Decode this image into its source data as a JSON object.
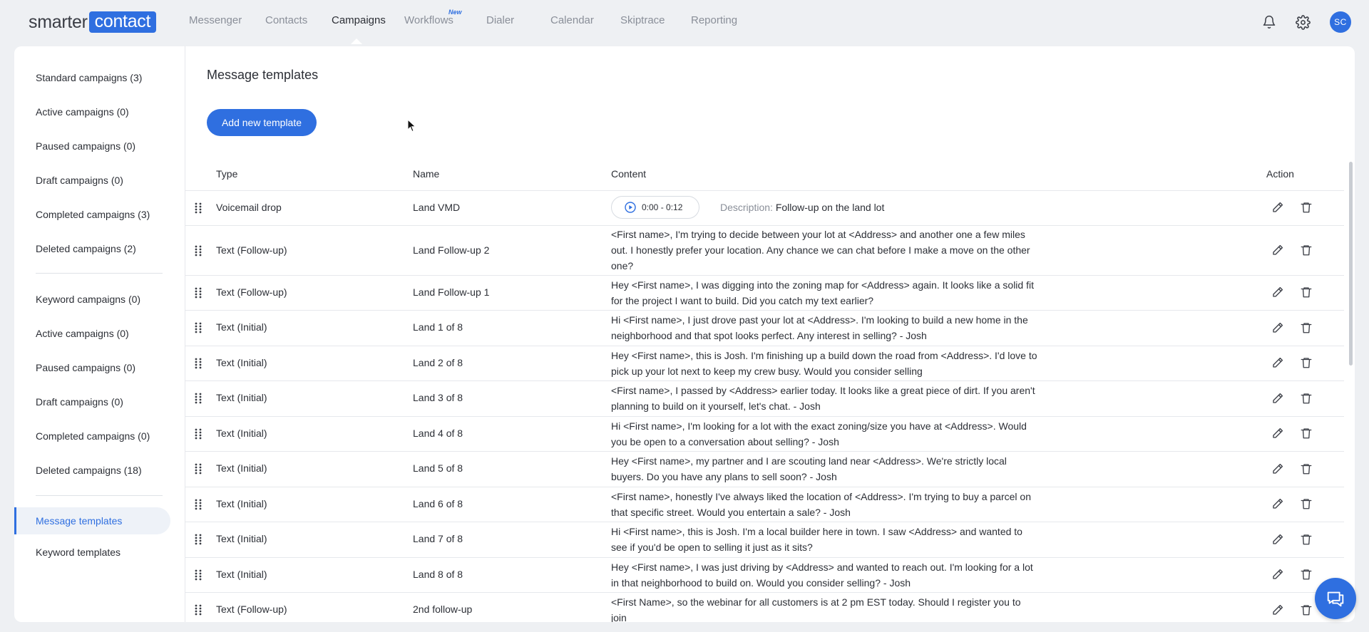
{
  "brand": {
    "part1": "smarter",
    "part2": "contact"
  },
  "nav": {
    "items": [
      "Messenger",
      "Contacts",
      "Campaigns",
      "Workflows",
      "Dialer",
      "Calendar",
      "Skiptrace",
      "Reporting"
    ],
    "active": "Campaigns",
    "workflows_badge": "New"
  },
  "user": {
    "initials": "SC"
  },
  "sidebar": {
    "standard_group": [
      "Standard campaigns (3)",
      "Active campaigns (0)",
      "Paused campaigns (0)",
      "Draft campaigns (0)",
      "Completed campaigns (3)",
      "Deleted campaigns (2)"
    ],
    "keyword_group": [
      "Keyword campaigns (0)",
      "Active campaigns (0)",
      "Paused campaigns (0)",
      "Draft campaigns (0)",
      "Completed campaigns (0)",
      "Deleted campaigns (18)"
    ],
    "templates_group": [
      "Message templates",
      "Keyword templates"
    ],
    "active_item": "Message templates"
  },
  "main": {
    "title": "Message templates",
    "add_button": "Add new template",
    "columns": {
      "type": "Type",
      "name": "Name",
      "content": "Content",
      "action": "Action"
    },
    "voicemail": {
      "type": "Voicemail drop",
      "name": "Land VMD",
      "audio_time": "0:00 - 0:12",
      "description_label": "Description:",
      "description": "Follow-up on the land lot"
    },
    "rows": [
      {
        "type": "Text (Follow-up)",
        "name": "Land Follow-up 2",
        "content": "<First name>, I'm trying to decide between your lot at <Address> and another one a few miles out. I honestly prefer your location. Any chance we can chat before I make a move on the other one?"
      },
      {
        "type": "Text (Follow-up)",
        "name": "Land Follow-up 1",
        "content": "Hey <First name>, I was digging into the zoning map for <Address> again. It looks like a solid fit for the project I want to build. Did you catch my text earlier?"
      },
      {
        "type": "Text (Initial)",
        "name": "Land 1 of 8",
        "content": "Hi <First name>, I just drove past your lot at <Address>. I'm looking to build a new home in the neighborhood and that spot looks perfect. Any interest in selling? - Josh"
      },
      {
        "type": "Text (Initial)",
        "name": "Land 2 of 8",
        "content": "Hey <First name>, this is Josh. I'm finishing up a build down the road from <Address>. I'd love to pick up your lot next to keep my crew busy. Would you consider selling"
      },
      {
        "type": "Text (Initial)",
        "name": "Land 3 of 8",
        "content": "<First name>, I passed by <Address> earlier today. It looks like a great piece of dirt. If you aren't planning to build on it yourself, let's chat. - Josh"
      },
      {
        "type": "Text (Initial)",
        "name": "Land 4 of 8",
        "content": "Hi <First name>, I'm looking for a lot with the exact zoning/size you have at <Address>. Would you be open to a conversation about selling? - Josh"
      },
      {
        "type": "Text (Initial)",
        "name": "Land 5 of 8",
        "content": "Hey <First name>, my partner and I are scouting land near <Address>. We're strictly local buyers. Do you have any plans to sell soon? - Josh"
      },
      {
        "type": "Text (Initial)",
        "name": "Land 6 of 8",
        "content": "<First name>, honestly I've always liked the location of <Address>. I'm trying to buy a parcel on that specific street. Would you entertain a sale? - Josh"
      },
      {
        "type": "Text (Initial)",
        "name": "Land 7 of 8",
        "content": "Hi <First name>, this is Josh. I'm a local builder here in town. I saw <Address> and wanted to see if you'd be open to selling it just as it sits?"
      },
      {
        "type": "Text (Initial)",
        "name": "Land 8 of 8",
        "content": "Hey <First name>, I was just driving by <Address> and wanted to reach out. I'm looking for a lot in that neighborhood to build on. Would you consider selling? - Josh"
      },
      {
        "type": "Text (Follow-up)",
        "name": "2nd follow-up",
        "content": "<First Name>, so the webinar for all customers is at 2 pm EST today. Should I register you to join"
      }
    ]
  }
}
